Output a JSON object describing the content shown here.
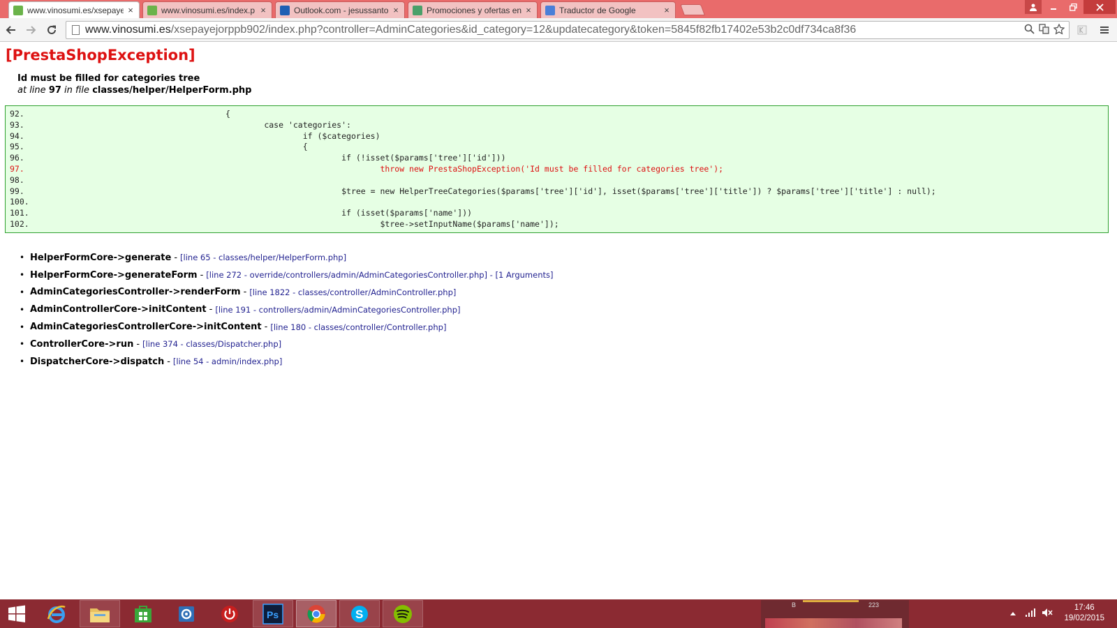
{
  "browser": {
    "tabs": [
      {
        "label": "www.vinosumi.es/xsepaye",
        "icon": "prestashop-favicon",
        "active": true
      },
      {
        "label": "www.vinosumi.es/index.p",
        "icon": "prestashop-favicon",
        "active": false
      },
      {
        "label": "Outlook.com - jesussanto",
        "icon": "outlook-favicon",
        "active": false
      },
      {
        "label": "Promociones y ofertas en",
        "icon": "promo-favicon",
        "active": false
      },
      {
        "label": "Traductor de Google",
        "icon": "google-translate-favicon",
        "active": false
      }
    ],
    "close_glyph": "×",
    "url_host": "www.vinosumi.es",
    "url_rest": "/xsepayejorppb902/index.php?controller=AdminCategories&id_category=12&updatecategory&token=5845f82fb17402e53b2c0df734ca8f36"
  },
  "page": {
    "exception_title": "[PrestaShopException]",
    "message": "Id must be filled for categories tree",
    "location": {
      "prefix": "at line",
      "line": "97",
      "infile": "in file",
      "file": "classes/helper/HelperForm.php"
    },
    "code_lines": [
      {
        "n": "92.",
        "code": "                                        {",
        "error": false
      },
      {
        "n": "93.",
        "code": "                                                case 'categories':",
        "error": false
      },
      {
        "n": "94.",
        "code": "                                                        if ($categories)",
        "error": false
      },
      {
        "n": "95.",
        "code": "                                                        {",
        "error": false
      },
      {
        "n": "96.",
        "code": "                                                                if (!isset($params['tree']['id']))",
        "error": false
      },
      {
        "n": "97.",
        "code": "                                                                        throw new PrestaShopException('Id must be filled for categories tree');",
        "error": true
      },
      {
        "n": "98.",
        "code": "",
        "error": false
      },
      {
        "n": "99.",
        "code": "                                                                $tree = new HelperTreeCategories($params['tree']['id'], isset($params['tree']['title']) ? $params['tree']['title'] : null);",
        "error": false
      },
      {
        "n": "100.",
        "code": "",
        "error": false
      },
      {
        "n": "101.",
        "code": "                                                                if (isset($params['name']))",
        "error": false
      },
      {
        "n": "102.",
        "code": "                                                                        $tree->setInputName($params['name']);",
        "error": false
      }
    ],
    "trace": [
      {
        "fn": "HelperFormCore->generate",
        "meta": "[line 65 - classes/helper/HelperForm.php]"
      },
      {
        "fn": "HelperFormCore->generateForm",
        "meta": "[line 272 - override/controllers/admin/AdminCategoriesController.php] - [1 Arguments]"
      },
      {
        "fn": "AdminCategoriesController->renderForm",
        "meta": "[line 1822 - classes/controller/AdminController.php]"
      },
      {
        "fn": "AdminControllerCore->initContent",
        "meta": "[line 191 - controllers/admin/AdminCategoriesController.php]"
      },
      {
        "fn": "AdminCategoriesControllerCore->initContent",
        "meta": "[line 180 - classes/controller/Controller.php]"
      },
      {
        "fn": "ControllerCore->run",
        "meta": "[line 374 - classes/Dispatcher.php]"
      },
      {
        "fn": "DispatcherCore->dispatch",
        "meta": "[line 54 - admin/index.php]"
      }
    ]
  },
  "taskbar": {
    "items": [
      {
        "name": "windows-start-icon"
      },
      {
        "name": "internet-explorer-icon"
      },
      {
        "name": "file-explorer-icon"
      },
      {
        "name": "windows-store-icon"
      },
      {
        "name": "control-panel-icon"
      },
      {
        "name": "power-icon"
      },
      {
        "name": "photoshop-icon"
      },
      {
        "name": "chrome-icon"
      },
      {
        "name": "skype-icon"
      },
      {
        "name": "spotify-icon"
      }
    ],
    "preview_letter": "B",
    "preview_count": "223",
    "clock_time": "17:46",
    "clock_date": "19/02/2015"
  }
}
